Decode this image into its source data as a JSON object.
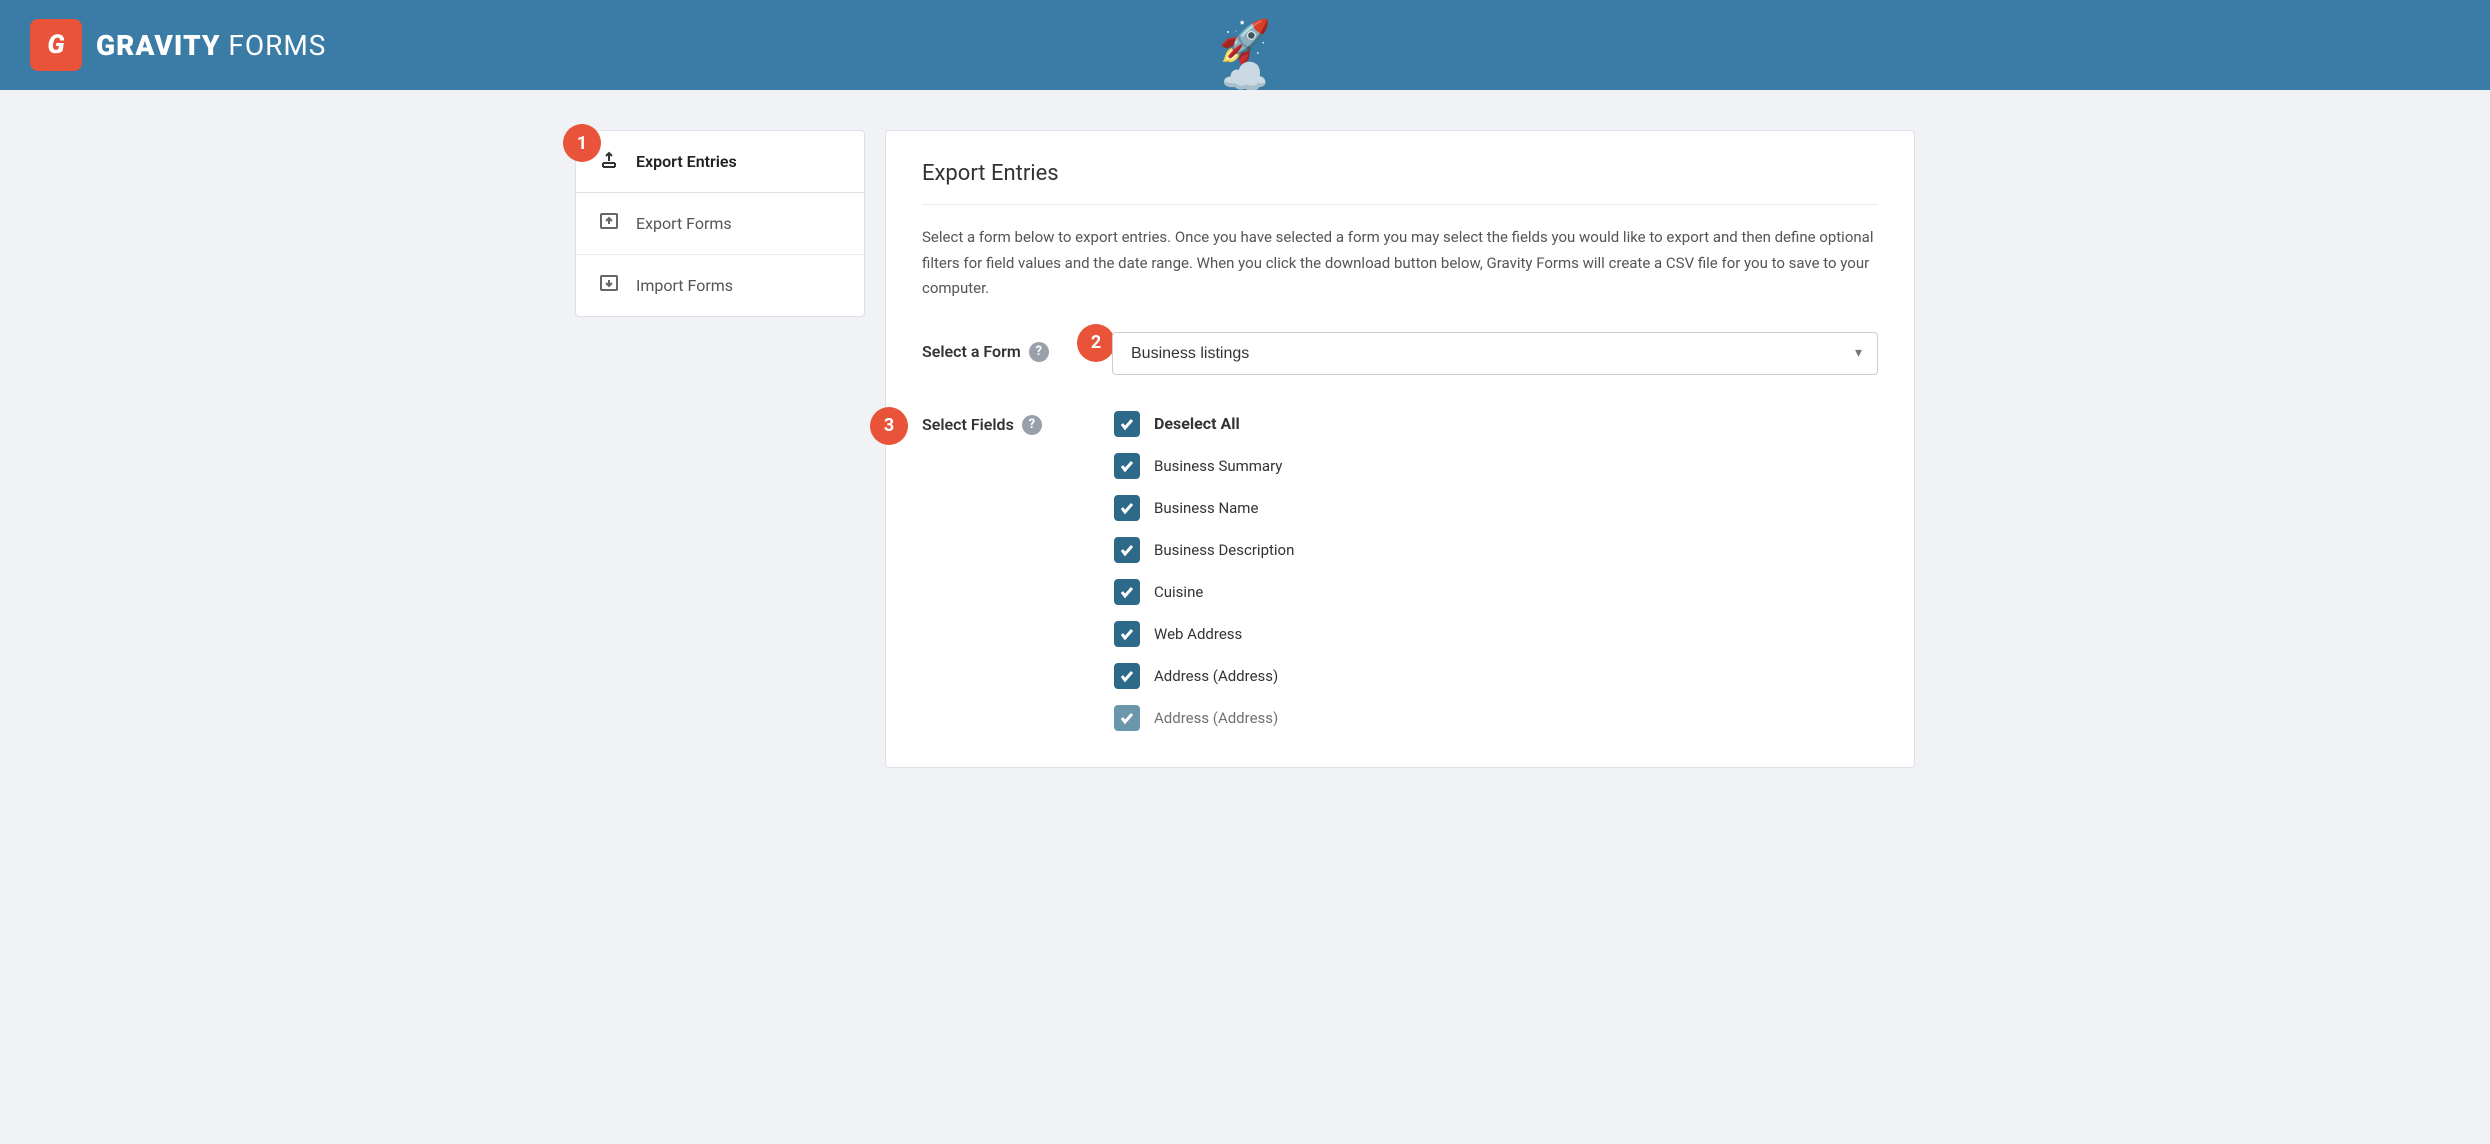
{
  "header": {
    "logo_letter": "G",
    "logo_bold": "GRAVITY",
    "logo_light": " FORMS"
  },
  "sidebar": {
    "items": [
      {
        "id": "export-entries",
        "label": "Export Entries",
        "icon": "export-entries",
        "active": true
      },
      {
        "id": "export-forms",
        "label": "Export Forms",
        "icon": "export-forms",
        "active": false
      },
      {
        "id": "import-forms",
        "label": "Import Forms",
        "icon": "import-forms",
        "active": false
      }
    ]
  },
  "content": {
    "title": "Export Entries",
    "description": "Select a form below to export entries. Once you have selected a form you may select the fields you would like to export and then define optional filters for field values and the date range. When you click the download button below, Gravity Forms will create a CSV file for you to save to your computer.",
    "select_form_label": "Select a Form",
    "select_form_value": "Business listings",
    "select_fields_label": "Select Fields",
    "fields": [
      {
        "id": "deselect-all",
        "label": "Deselect All",
        "checked": true,
        "bold": true
      },
      {
        "id": "business-summary",
        "label": "Business Summary",
        "checked": true,
        "bold": false
      },
      {
        "id": "business-name",
        "label": "Business Name",
        "checked": true,
        "bold": false
      },
      {
        "id": "business-description",
        "label": "Business Description",
        "checked": true,
        "bold": false
      },
      {
        "id": "cuisine",
        "label": "Cuisine",
        "checked": true,
        "bold": false
      },
      {
        "id": "web-address",
        "label": "Web Address",
        "checked": true,
        "bold": false
      },
      {
        "id": "address-1",
        "label": "Address (Address)",
        "checked": true,
        "bold": false
      },
      {
        "id": "address-2",
        "label": "Address (Address)",
        "checked": true,
        "bold": false
      }
    ]
  },
  "steps": {
    "step1": "1",
    "step2": "2",
    "step3": "3"
  }
}
